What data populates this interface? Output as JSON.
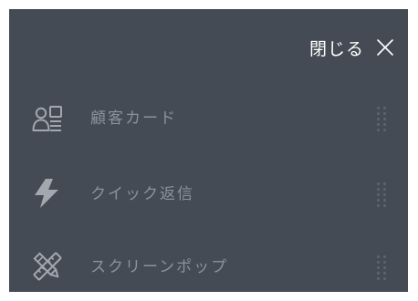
{
  "header": {
    "close_label": "閉じる"
  },
  "menu": {
    "items": [
      {
        "label": "顧客カード",
        "icon": "customer-card-icon"
      },
      {
        "label": "クイック返信",
        "icon": "lightning-bolt-icon"
      },
      {
        "label": "スクリーンポップ",
        "icon": "pencil-ruler-icon"
      }
    ]
  },
  "colors": {
    "panel_background": "#444b54",
    "close_text": "#ffffff",
    "item_text": "#8c929a",
    "icon": "#a3a8ae",
    "drag_dots": "#5c636c"
  }
}
